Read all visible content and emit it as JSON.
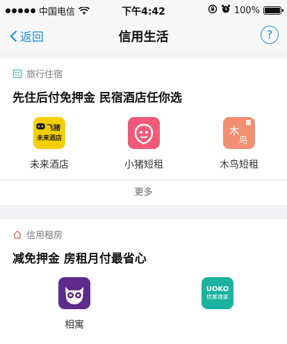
{
  "status": {
    "carrier": "中国电信",
    "time": "下午4:42",
    "battery": "100%"
  },
  "nav": {
    "back_label": "返回",
    "title": "信用生活",
    "help": "?"
  },
  "sections": [
    {
      "label": "旅行住宿",
      "headline": "先住后付免押金 民宿酒店任你选",
      "apps": [
        {
          "name": "未来酒店",
          "icon": "feizhu-hotel-icon",
          "icon_text_top": "飞猪",
          "icon_text_bottom": "未来酒店",
          "color": "#f7cf00"
        },
        {
          "name": "小猪短租",
          "icon": "xiaozhu-icon",
          "color": "#f05a78"
        },
        {
          "name": "木鸟短租",
          "icon": "muniao-icon",
          "icon_text_top": "木",
          "icon_text_bottom": "鸟",
          "color": "#f28f73"
        }
      ],
      "more": "更多"
    },
    {
      "label": "信用租房",
      "headline": "减免押金 房租月付最省心",
      "apps": [
        {
          "name": "相寓",
          "icon": "xiangyu-owl-icon",
          "color": "#5e2a8c"
        },
        {
          "name": "",
          "icon": "uoko-icon",
          "icon_text_top": "UOKO",
          "icon_text_bottom": "优客逸家",
          "color": "#19b3a0"
        }
      ]
    }
  ],
  "colors": {
    "accent": "#1a8ee0",
    "page_bg": "#f2f2f4"
  }
}
